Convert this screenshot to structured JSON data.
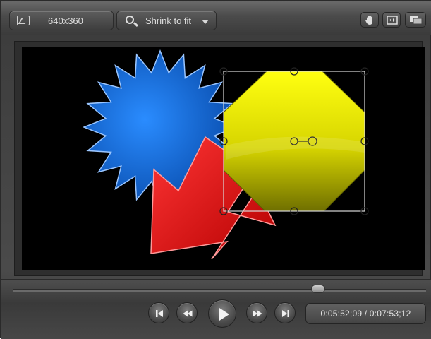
{
  "toolbar": {
    "canvas_size": "640x360",
    "zoom_label": "Shrink to fit",
    "icons": [
      "canvas-dimensions-icon",
      "zoom-icon",
      "hand-pan-icon",
      "fit-to-window-icon",
      "detach-window-icon"
    ]
  },
  "playback": {
    "timecode": "0:05:52;09 / 0:07:53;12",
    "icons": [
      "go-to-start-icon",
      "rewind-icon",
      "play-icon",
      "fast-forward-icon",
      "go-to-end-icon"
    ]
  },
  "colors": {
    "starburst": "#1473e6",
    "arrow": "#e01a1a",
    "octagon": "#e8e600",
    "canvas_background": "#000000"
  }
}
